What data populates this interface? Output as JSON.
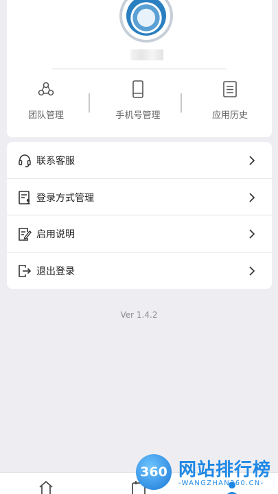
{
  "profile": {
    "quick_actions": [
      {
        "label": "团队管理",
        "icon": "team-icon"
      },
      {
        "label": "手机号管理",
        "icon": "phone-icon"
      },
      {
        "label": "应用历史",
        "icon": "history-icon"
      }
    ]
  },
  "menu": {
    "items": [
      {
        "label": "联系客服",
        "icon": "headset-icon"
      },
      {
        "label": "登录方式管理",
        "icon": "login-method-icon"
      },
      {
        "label": "启用说明",
        "icon": "instructions-icon"
      },
      {
        "label": "退出登录",
        "icon": "logout-icon"
      }
    ]
  },
  "version": "Ver 1.4.2",
  "watermark": {
    "badge": "360",
    "title": "网站排行榜",
    "subtitle": "-WANGZHAN360.CN-"
  },
  "tabbar": {
    "tabs": [
      {
        "icon": "home-icon"
      },
      {
        "icon": "calendar-icon"
      },
      {
        "icon": "user-icon"
      }
    ]
  },
  "colors": {
    "accent": "#1e88e5",
    "background": "#eeeef2"
  }
}
